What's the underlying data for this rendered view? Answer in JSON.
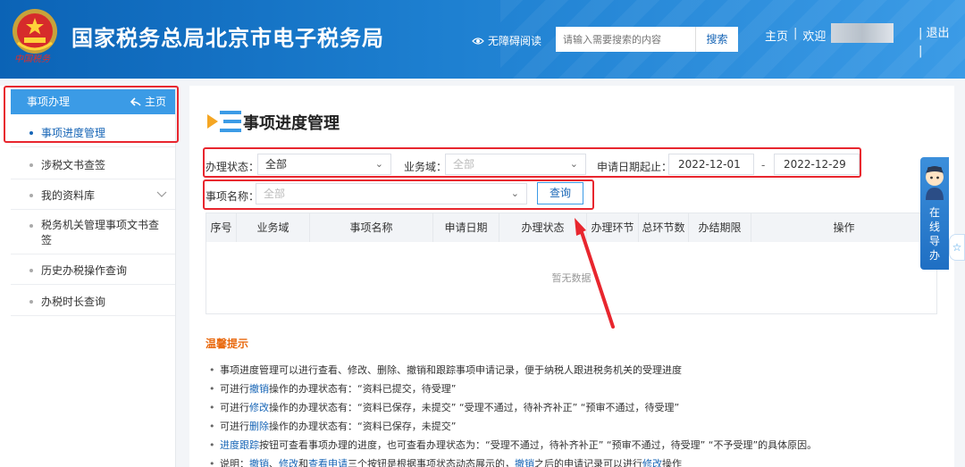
{
  "header": {
    "site_title": "国家税务总局北京市电子税务局",
    "emblem_sign": "中国税务",
    "accessibility_label": "无障碍阅读",
    "search_placeholder": "请输入需要搜索的内容",
    "search_button": "搜索",
    "nav_home": "主页",
    "nav_sep": "|",
    "nav_welcome": "欢迎",
    "logout": "退出"
  },
  "sidebar": {
    "header_label": "事项办理",
    "home_label": "主页",
    "items": [
      {
        "label": "事项进度管理",
        "active": true
      },
      {
        "label": "涉税文书查签"
      },
      {
        "label": "我的资料库"
      },
      {
        "label": "税务机关管理事项文书查签"
      },
      {
        "label": "历史办税操作查询"
      },
      {
        "label": "办税时长查询"
      }
    ]
  },
  "main": {
    "page_title": "事项进度管理",
    "filters": {
      "status_label": "办理状态：",
      "status_value": "全部",
      "domain_label": "业务域：",
      "domain_value": "全部",
      "date_label": "申请日期起止：",
      "date_start": "2022-12-01",
      "date_dash": "-",
      "date_end": "2022-12-29",
      "name_label": "事项名称：",
      "name_value": "全部",
      "query_button": "查询"
    },
    "table": {
      "columns": [
        "序号",
        "业务域",
        "事项名称",
        "申请日期",
        "办理状态",
        "办理环节",
        "总环节数",
        "办结期限",
        "操作"
      ],
      "empty_text": "暂无数据"
    },
    "tips": {
      "title": "温馨提示",
      "lines": [
        [
          {
            "t": "事项进度管理可以进行查看、修改、删除、撤销和跟踪事项申请记录，便于纳税人跟进税务机关的受理进度"
          }
        ],
        [
          {
            "t": "可进行"
          },
          {
            "t": "撤销",
            "link": true
          },
          {
            "t": "操作的办理状态有：“资料已提交，待受理”"
          }
        ],
        [
          {
            "t": "可进行"
          },
          {
            "t": "修改",
            "link": true
          },
          {
            "t": "操作的办理状态有：“资料已保存，未提交”  “受理不通过，待补齐补正”  “预审不通过，待受理”"
          }
        ],
        [
          {
            "t": "可进行"
          },
          {
            "t": "删除",
            "link": true
          },
          {
            "t": "操作的办理状态有：“资料已保存，未提交”"
          }
        ],
        [
          {
            "t": "进度跟踪",
            "link": true
          },
          {
            "t": "按钮可查看事项办理的进度，也可查看办理状态为：“受理不通过，待补齐补正”  “预审不通过，待受理”  “不予受理”的具体原因。"
          }
        ],
        [
          {
            "t": "说明："
          },
          {
            "t": "撤销",
            "link": true
          },
          {
            "t": "、"
          },
          {
            "t": "修改",
            "link": true
          },
          {
            "t": "和"
          },
          {
            "t": "查看申请",
            "link": true
          },
          {
            "t": "三个按钮是根据事项状态动态展示的，"
          },
          {
            "t": "撤销",
            "link": true
          },
          {
            "t": "之后的申请记录可以进行"
          },
          {
            "t": "修改",
            "link": true
          },
          {
            "t": "操作"
          }
        ]
      ]
    }
  },
  "float_guide": {
    "label_chars": [
      "在",
      "线",
      "导",
      "办"
    ],
    "star": "☆"
  },
  "colors": {
    "brand_blue": "#1765b6",
    "header_blue": "#1d7fd0",
    "annotation_red": "#e8262e",
    "tips_orange": "#e96a10"
  }
}
